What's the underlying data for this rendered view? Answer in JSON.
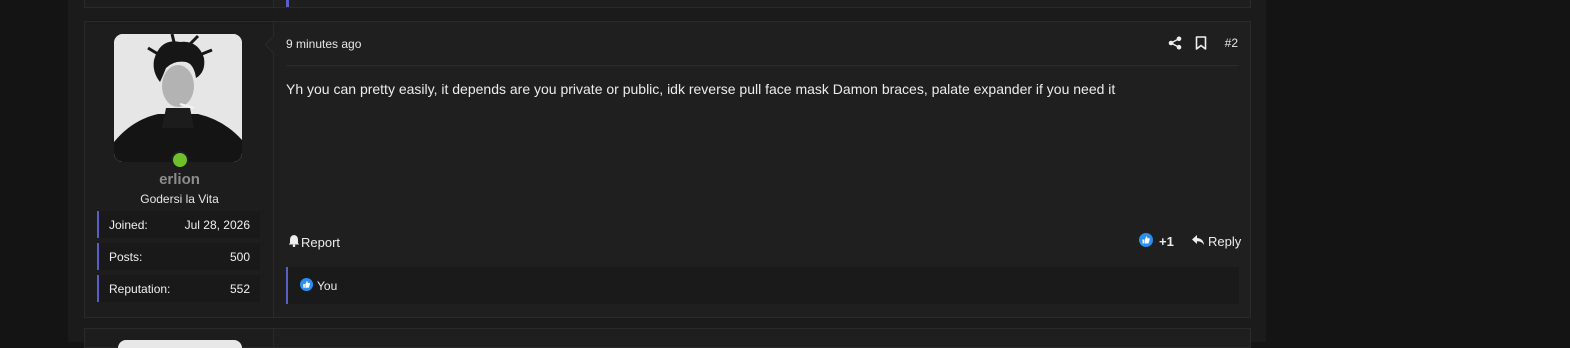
{
  "post": {
    "timestamp": "9 minutes ago",
    "post_number": "#2",
    "message": "Yh you can pretty easily, it depends are you private or public, idk reverse pull face mask Damon braces, palate expander if you need it",
    "actions": {
      "share_icon": "share-icon",
      "bookmark_icon": "bookmark-icon"
    },
    "footer": {
      "report_label": "Report",
      "report_icon": "bell-icon",
      "reaction_icon": "thumbs-up-icon",
      "reaction_count": "+1",
      "reply_label": "Reply",
      "reply_icon": "reply-arrow-icon"
    },
    "reactions_list": {
      "icon": "thumbs-up-icon",
      "label": "You"
    }
  },
  "user": {
    "username": "erlion",
    "title": "Godersi la Vita",
    "online": true,
    "stats": [
      {
        "label": "Joined:",
        "value": "Jul 28, 2026"
      },
      {
        "label": "Posts:",
        "value": "500"
      },
      {
        "label": "Reputation:",
        "value": "552"
      }
    ]
  },
  "colors": {
    "accent": "#5a5fc7",
    "online": "#6fbf2a",
    "like_blue": "#2b8ff0",
    "username": "#8c8c8c"
  }
}
